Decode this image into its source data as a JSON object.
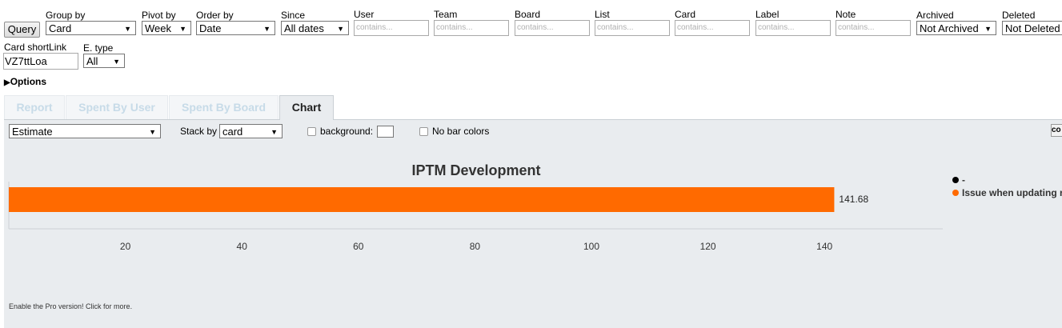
{
  "query": {
    "button_label": "Query"
  },
  "filters": {
    "group_by": {
      "label": "Group by",
      "value": "Card"
    },
    "pivot_by": {
      "label": "Pivot by",
      "value": "Week"
    },
    "order_by": {
      "label": "Order by",
      "value": "Date"
    },
    "since": {
      "label": "Since",
      "value": "All dates"
    },
    "user": {
      "label": "User",
      "placeholder": "contains..."
    },
    "team": {
      "label": "Team",
      "placeholder": "contains..."
    },
    "board": {
      "label": "Board",
      "placeholder": "contains..."
    },
    "list": {
      "label": "List",
      "placeholder": "contains..."
    },
    "card": {
      "label": "Card",
      "placeholder": "contains..."
    },
    "label": {
      "label": "Label",
      "placeholder": "contains..."
    },
    "note": {
      "label": "Note",
      "placeholder": "contains..."
    },
    "archived": {
      "label": "Archived",
      "value": "Not Archived"
    },
    "deleted": {
      "label": "Deleted",
      "value": "Not Deleted"
    },
    "card_shortlink": {
      "label": "Card shortLink",
      "value": "VZ7ttLoa"
    },
    "e_type": {
      "label": "E. type",
      "value": "All"
    }
  },
  "options_toggle": {
    "arrow": "▶",
    "label": "Options"
  },
  "tabs": [
    {
      "label": "Report"
    },
    {
      "label": "Spent By User"
    },
    {
      "label": "Spent By Board"
    },
    {
      "label": "Chart"
    }
  ],
  "chart_controls": {
    "measure": "Estimate",
    "stack_by_label": "Stack by",
    "stack_by_value": "card",
    "background_label": "background:",
    "no_bar_colors_label": "No bar colors",
    "corner_button": "co"
  },
  "chart_data": {
    "type": "bar",
    "orientation": "horizontal",
    "title": "IPTM Development",
    "categories": [
      "IPTM Development"
    ],
    "series": [
      {
        "name": "Issue when updating r",
        "values": [
          141.68
        ],
        "color": "#ff6a00"
      }
    ],
    "data_labels": [
      "141.68"
    ],
    "x_ticks": [
      20,
      40,
      60,
      80,
      100,
      120,
      140
    ],
    "xlim": [
      0,
      160
    ],
    "legend": [
      {
        "label": "-",
        "color": "#000000"
      },
      {
        "label": "Issue when updating r",
        "color": "#ff6a00"
      }
    ],
    "legend_position": "right"
  },
  "footer": {
    "pro_text": "Enable the Pro version! Click for more."
  }
}
